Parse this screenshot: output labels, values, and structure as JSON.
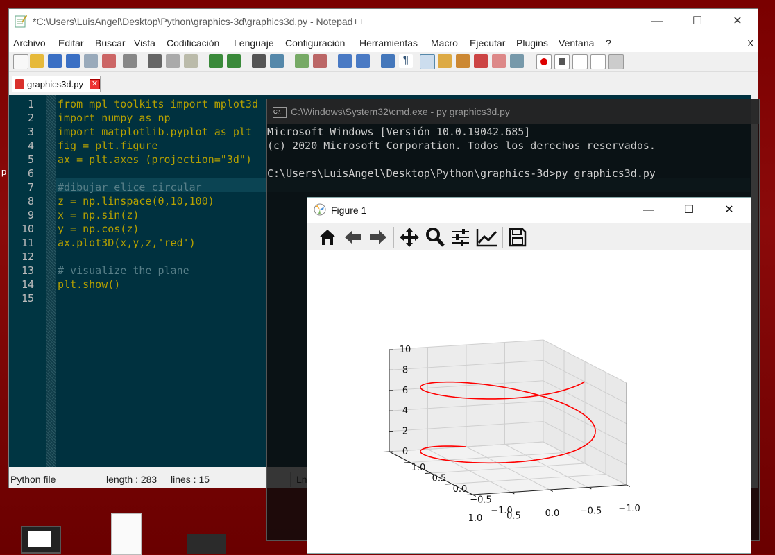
{
  "notepad": {
    "title": "*C:\\Users\\LuisAngel\\Desktop\\Python\\graphics-3d\\graphics3d.py - Notepad++",
    "menu": [
      "Archivo",
      "Editar",
      "Buscar",
      "Vista",
      "Codificación",
      "Lenguaje",
      "Configuración",
      "Herramientas",
      "Macro",
      "Ejecutar",
      "Plugins",
      "Ventana",
      "?"
    ],
    "menu_close": "X",
    "tab": "graphics3d.py",
    "tab_close": "✕",
    "lines": [
      {
        "n": "1",
        "text": "from mpl_toolkits import mplot3d",
        "color": "#b5a000"
      },
      {
        "n": "2",
        "text": "import numpy as np",
        "color": "#b5a000"
      },
      {
        "n": "3",
        "text": "import matplotlib.pyplot as plt",
        "color": "#b5a000"
      },
      {
        "n": "4",
        "text": "fig = plt.figure",
        "color": "#b5a000"
      },
      {
        "n": "5",
        "text": "ax = plt.axes (projection=\"3d\")",
        "color": "#b5a000"
      },
      {
        "n": "6",
        "text": "",
        "color": "#b5a000"
      },
      {
        "n": "7",
        "text": "#dibujar elice circular",
        "color": "#587f88"
      },
      {
        "n": "8",
        "text": "z = np.linspace(0,10,100)",
        "color": "#b5a000"
      },
      {
        "n": "9",
        "text": "x = np.sin(z)",
        "color": "#b5a000"
      },
      {
        "n": "10",
        "text": "y = np.cos(z)",
        "color": "#b5a000"
      },
      {
        "n": "11",
        "text": "ax.plot3D(x,y,z,'red')",
        "color": "#b5a000"
      },
      {
        "n": "12",
        "text": "",
        "color": "#b5a000"
      },
      {
        "n": "13",
        "text": "# visualize the plane",
        "color": "#587f88"
      },
      {
        "n": "14",
        "text": "plt.show()",
        "color": "#b5a000"
      },
      {
        "n": "15",
        "text": "",
        "color": "#b5a000"
      }
    ],
    "status": {
      "type": "Python file",
      "length": "length : 283",
      "lines": "lines : 15",
      "ln": "Ln"
    }
  },
  "cmd": {
    "title": "C:\\Windows\\System32\\cmd.exe - py  graphics3d.py",
    "lines": [
      "Microsoft Windows [Versión 10.0.19042.685]",
      "(c) 2020 Microsoft Corporation. Todos los derechos reservados.",
      "",
      "C:\\Users\\LuisAngel\\Desktop\\Python\\graphics-3d>py graphics3d.py"
    ]
  },
  "figure": {
    "title": "Figure 1",
    "toolbar": [
      "home-icon",
      "back-icon",
      "forward-icon",
      "pan-icon",
      "zoom-icon",
      "configure-subplots-icon",
      "edit-axes-icon",
      "save-icon"
    ]
  },
  "chart_data": {
    "type": "line",
    "projection": "3d",
    "series": [
      {
        "color": "#ff0000",
        "x": "sin(z)",
        "y": "cos(z)",
        "z": "linspace(0,10,100)"
      }
    ],
    "x_ticks": [
      "−1.0",
      "−0.5",
      "0.0",
      "0.5",
      "1.0"
    ],
    "y_ticks": [
      "1.0",
      "0.5",
      "0.0",
      "−0.5",
      "−1.0"
    ],
    "z_ticks": [
      "10",
      "8",
      "6",
      "4",
      "2",
      "0"
    ],
    "xlim": [
      -1,
      1
    ],
    "ylim": [
      -1,
      1
    ],
    "zlim": [
      0,
      10
    ],
    "grid": true
  },
  "window_controls": {
    "minimize": "—",
    "maximize": "☐",
    "close": "✕"
  }
}
